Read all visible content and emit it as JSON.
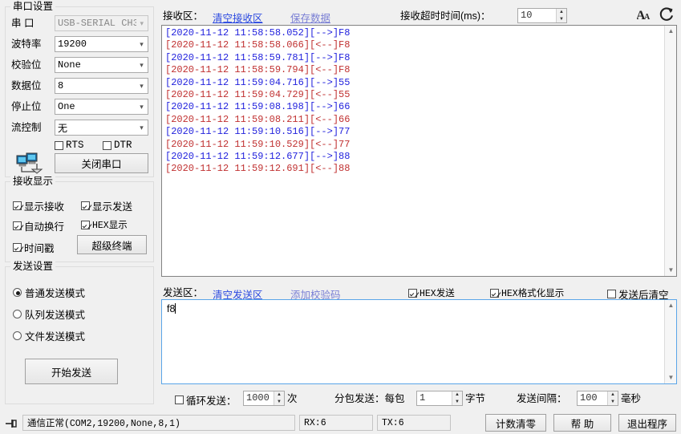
{
  "serial_settings": {
    "title": "串口设置",
    "fields": [
      {
        "label": "串    口",
        "value": "USB-SERIAL CH3",
        "disabled": true
      },
      {
        "label": "波特率",
        "value": "19200",
        "disabled": false
      },
      {
        "label": "校验位",
        "value": "None",
        "disabled": false
      },
      {
        "label": "数据位",
        "value": "8",
        "disabled": false
      },
      {
        "label": "停止位",
        "value": "One",
        "disabled": false
      },
      {
        "label": "流控制",
        "value": "无",
        "disabled": false
      }
    ],
    "rts": {
      "label": "RTS",
      "checked": false
    },
    "dtr": {
      "label": "DTR",
      "checked": false
    },
    "close_port_button": "关闭串口",
    "port_icon": "two-computers-network-icon"
  },
  "receive_display": {
    "title": "接收显示",
    "options": [
      {
        "label": "显示接收",
        "checked": true
      },
      {
        "label": "显示发送",
        "checked": true
      },
      {
        "label": "自动换行",
        "checked": true
      },
      {
        "label": "HEX显示",
        "checked": true
      },
      {
        "label": "时间戳",
        "checked": true
      }
    ],
    "hyper_terminal_button": "超级终端"
  },
  "send_settings": {
    "title": "发送设置",
    "modes": [
      {
        "label": "普通发送模式",
        "selected": true
      },
      {
        "label": "队列发送模式",
        "selected": false
      },
      {
        "label": "文件发送模式",
        "selected": false
      }
    ],
    "start_send_button": "开始发送"
  },
  "receive_panel": {
    "label": "接收区：",
    "clear_link": "清空接收区",
    "save_link": "保存数据",
    "timeout_label": "接收超时时间(ms)：",
    "timeout_value": "10",
    "font_icon": "font-size-icon",
    "refresh_icon": "refresh-icon",
    "colors": {
      "sent": "#2222dd",
      "received": "#c03030"
    },
    "log_lines": [
      {
        "text": "[2020-11-12 11:58:58.052][-->]F8",
        "dir": "sent"
      },
      {
        "text": "[2020-11-12 11:58:58.066][<--]F8",
        "dir": "received"
      },
      {
        "text": "[2020-11-12 11:58:59.781][-->]F8",
        "dir": "sent"
      },
      {
        "text": "[2020-11-12 11:58:59.794][<--]F8",
        "dir": "received"
      },
      {
        "text": "[2020-11-12 11:59:04.716][-->]55",
        "dir": "sent"
      },
      {
        "text": "[2020-11-12 11:59:04.729][<--]55",
        "dir": "received"
      },
      {
        "text": "[2020-11-12 11:59:08.198][-->]66",
        "dir": "sent"
      },
      {
        "text": "[2020-11-12 11:59:08.211][<--]66",
        "dir": "received"
      },
      {
        "text": "[2020-11-12 11:59:10.516][-->]77",
        "dir": "sent"
      },
      {
        "text": "[2020-11-12 11:59:10.529][<--]77",
        "dir": "received"
      },
      {
        "text": "[2020-11-12 11:59:12.677][-->]88",
        "dir": "sent"
      },
      {
        "text": "[2020-11-12 11:59:12.691][<--]88",
        "dir": "received"
      }
    ]
  },
  "send_panel": {
    "label": "发送区：",
    "clear_link": "清空发送区",
    "checksum_link": "添加校验码",
    "hex_send": {
      "label": "HEX发送",
      "checked": true
    },
    "hex_format": {
      "label": "HEX格式化显示",
      "checked": true
    },
    "clear_after_send": {
      "label": "发送后清空",
      "checked": false
    },
    "text_value": "f8"
  },
  "send_options": {
    "cycle": {
      "label": "循环发送：",
      "checked": false,
      "value": "1000",
      "unit": "次"
    },
    "packet": {
      "label": "分包发送：每包",
      "value": "1",
      "unit": "字节"
    },
    "interval": {
      "label": "发送间隔：",
      "value": "100",
      "unit": "毫秒"
    }
  },
  "status_bar": {
    "pin_icon": "pin-icon",
    "status_text": "通信正常(COM2,19200,None,8,1)",
    "rx": "RX:6",
    "tx": "TX:6",
    "clear_counter_button": "计数清零",
    "help_button": "帮  助",
    "exit_button": "退出程序"
  }
}
